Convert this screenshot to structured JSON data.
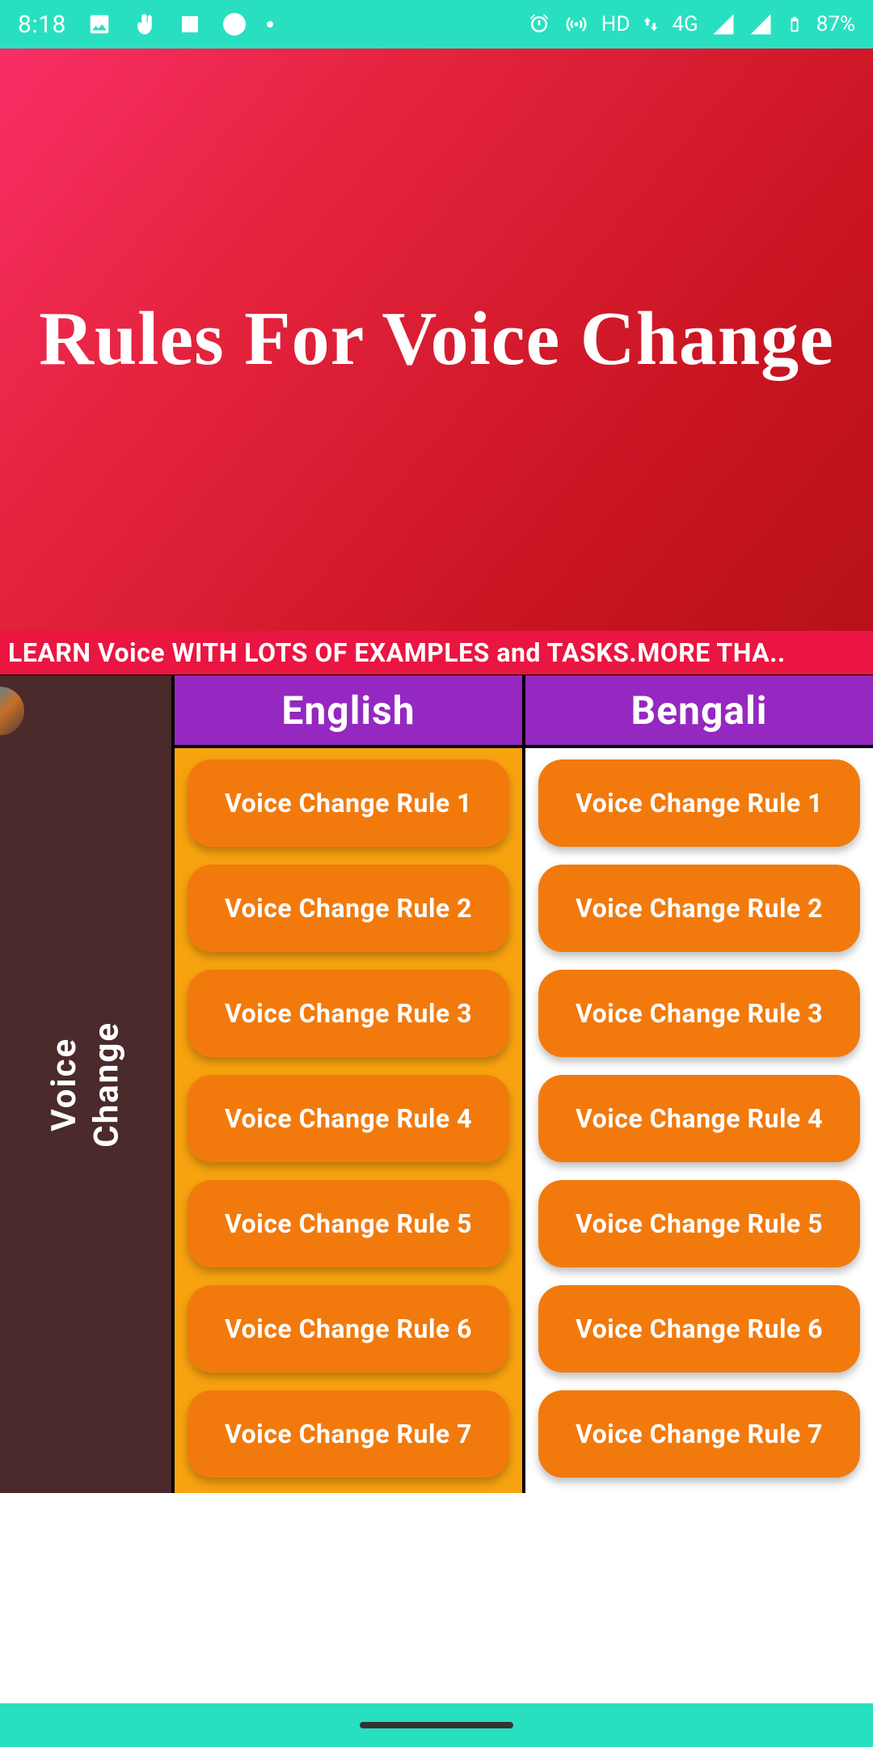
{
  "statusbar": {
    "time": "8:18",
    "hd": "HD",
    "net": "4G",
    "battery": "87%"
  },
  "hero": {
    "title": "Rules For Voice Change"
  },
  "banner": {
    "text": "LEARN Voice WITH LOTS OF EXAMPLES and TASKS.MORE THA.."
  },
  "sidebar": {
    "label": "Voice\nChange"
  },
  "columns": {
    "english": {
      "header": "English",
      "rules": [
        "Voice Change Rule 1",
        "Voice Change Rule 2",
        "Voice Change Rule 3",
        "Voice Change Rule 4",
        "Voice Change Rule 5",
        "Voice Change Rule 6",
        "Voice Change Rule 7"
      ]
    },
    "bengali": {
      "header": "Bengali",
      "rules": [
        "Voice Change Rule 1",
        "Voice Change Rule 2",
        "Voice Change Rule 3",
        "Voice Change Rule 4",
        "Voice Change Rule 5",
        "Voice Change Rule 6",
        "Voice Change Rule 7"
      ]
    }
  }
}
